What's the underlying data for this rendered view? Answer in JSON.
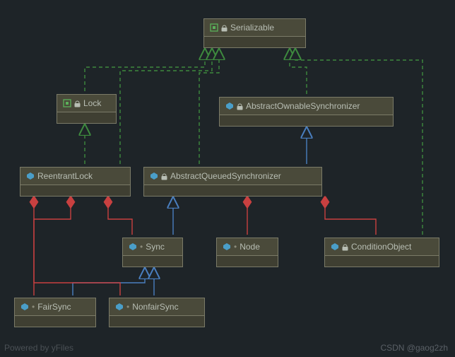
{
  "nodes": {
    "serializable": {
      "label": "Serializable"
    },
    "lock": {
      "label": "Lock"
    },
    "aos": {
      "label": "AbstractOwnableSynchronizer"
    },
    "reentrant": {
      "label": "ReentrantLock"
    },
    "aqs": {
      "label": "AbstractQueuedSynchronizer"
    },
    "sync": {
      "label": "Sync"
    },
    "node": {
      "label": "Node"
    },
    "condition": {
      "label": "ConditionObject"
    },
    "fair": {
      "label": "FairSync"
    },
    "nonfair": {
      "label": "NonfairSync"
    }
  },
  "footer": {
    "watermark": "Powered by yFiles",
    "credit": "CSDN @gaog2zh"
  },
  "chart_data": {
    "type": "class-diagram",
    "nodes": [
      {
        "id": "Serializable",
        "kind": "interface"
      },
      {
        "id": "Lock",
        "kind": "interface"
      },
      {
        "id": "AbstractOwnableSynchronizer",
        "kind": "class"
      },
      {
        "id": "ReentrantLock",
        "kind": "class"
      },
      {
        "id": "AbstractQueuedSynchronizer",
        "kind": "class"
      },
      {
        "id": "Sync",
        "kind": "class"
      },
      {
        "id": "Node",
        "kind": "class"
      },
      {
        "id": "ConditionObject",
        "kind": "class"
      },
      {
        "id": "FairSync",
        "kind": "class"
      },
      {
        "id": "NonfairSync",
        "kind": "class"
      }
    ],
    "edges": [
      {
        "from": "Lock",
        "to": "Serializable",
        "relation": "realization"
      },
      {
        "from": "AbstractOwnableSynchronizer",
        "to": "Serializable",
        "relation": "realization"
      },
      {
        "from": "ReentrantLock",
        "to": "Lock",
        "relation": "realization"
      },
      {
        "from": "ReentrantLock",
        "to": "Serializable",
        "relation": "realization"
      },
      {
        "from": "AbstractQueuedSynchronizer",
        "to": "Serializable",
        "relation": "realization"
      },
      {
        "from": "ConditionObject",
        "to": "Serializable",
        "relation": "realization"
      },
      {
        "from": "AbstractQueuedSynchronizer",
        "to": "AbstractOwnableSynchronizer",
        "relation": "generalization"
      },
      {
        "from": "Sync",
        "to": "AbstractQueuedSynchronizer",
        "relation": "generalization"
      },
      {
        "from": "FairSync",
        "to": "Sync",
        "relation": "generalization"
      },
      {
        "from": "NonfairSync",
        "to": "Sync",
        "relation": "generalization"
      },
      {
        "from": "ReentrantLock",
        "to": "Sync",
        "relation": "composition"
      },
      {
        "from": "ReentrantLock",
        "to": "FairSync",
        "relation": "composition"
      },
      {
        "from": "ReentrantLock",
        "to": "NonfairSync",
        "relation": "composition"
      },
      {
        "from": "AbstractQueuedSynchronizer",
        "to": "Node",
        "relation": "composition"
      },
      {
        "from": "AbstractQueuedSynchronizer",
        "to": "ConditionObject",
        "relation": "composition"
      }
    ]
  }
}
